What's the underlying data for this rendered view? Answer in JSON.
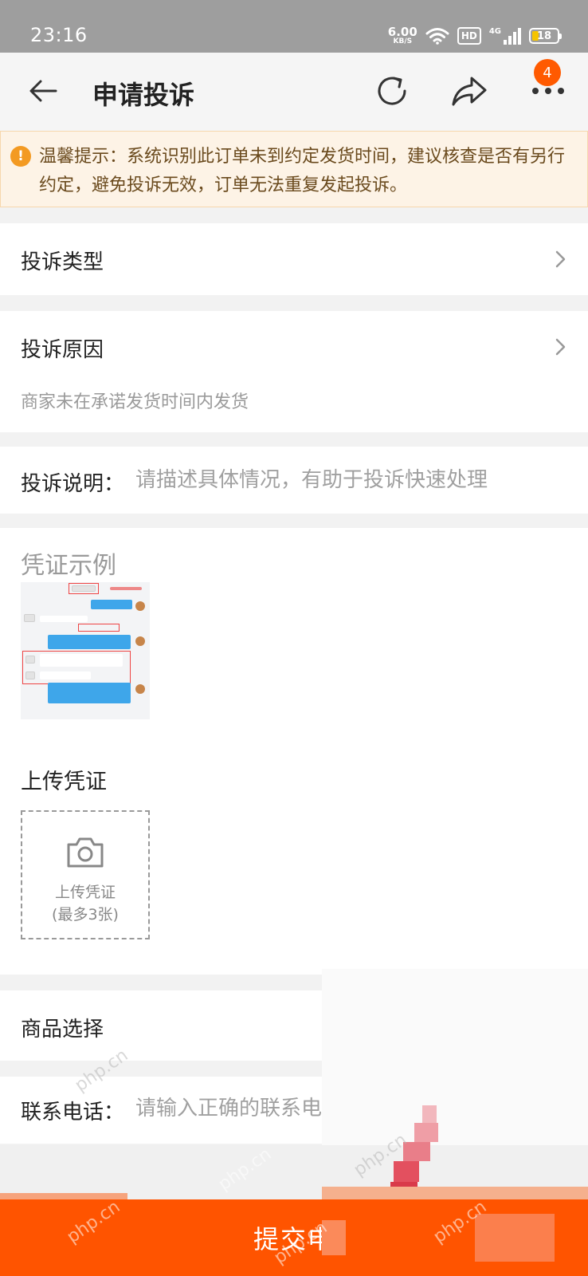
{
  "status_bar": {
    "time": "23:16",
    "net_speed": "6.00",
    "net_unit": "KB/S",
    "hd": "HD",
    "network": "4G",
    "battery": "18"
  },
  "header": {
    "title": "申请投诉",
    "menu_badge": "4"
  },
  "tip": {
    "text": "温馨提示：系统识别此订单未到约定发货时间，建议核查是否有另行约定，避免投诉无效，订单无法重复发起投诉。"
  },
  "complaint_type": {
    "label": "投诉类型"
  },
  "complaint_reason": {
    "label": "投诉原因",
    "value": "商家未在承诺发货时间内发货"
  },
  "complaint_description": {
    "label": "投诉说明：",
    "placeholder": "请描述具体情况，有助于投诉快速处理"
  },
  "evidence_example": {
    "title": "凭证示例"
  },
  "upload": {
    "title": "上传凭证",
    "box_label": "上传凭证",
    "box_hint": "(最多3张)"
  },
  "product_select": {
    "label": "商品选择"
  },
  "contact_phone": {
    "label": "联系电话：",
    "placeholder": "请输入正确的联系电"
  },
  "submit": {
    "label": "提交申"
  },
  "watermark": "php.cn",
  "colors": {
    "accent": "#ff5400",
    "tip_bg": "#fdf3e6",
    "tip_icon": "#f39a22",
    "status_bar": "#9e9e9e"
  }
}
